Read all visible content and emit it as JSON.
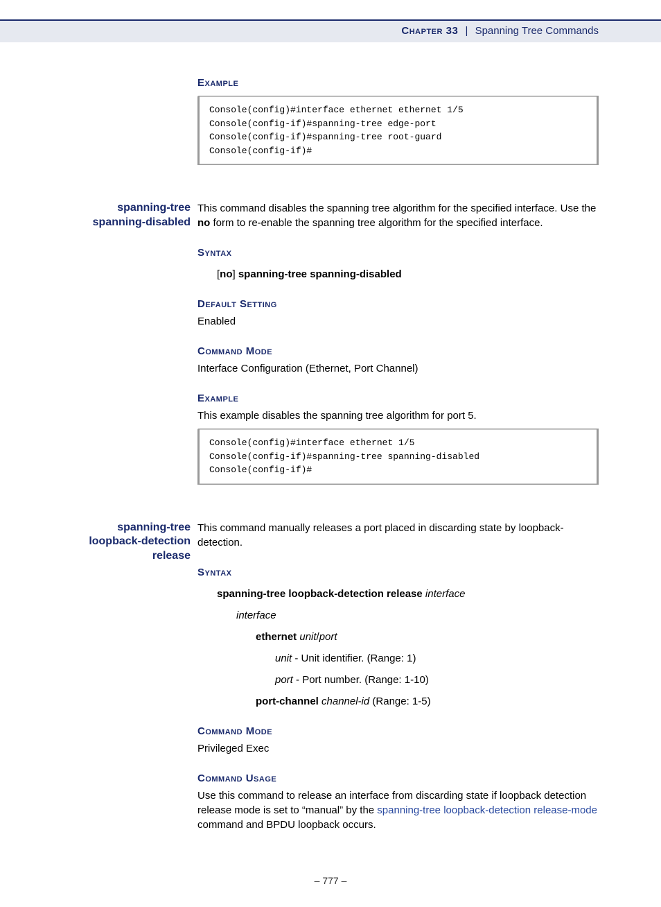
{
  "header": {
    "chapter_label": "Chapter 33",
    "sep": "|",
    "title": "Spanning Tree Commands"
  },
  "sec1": {
    "h_example": "Example",
    "code": "Console(config)#interface ethernet ethernet 1/5\nConsole(config-if)#spanning-tree edge-port\nConsole(config-if)#spanning-tree root-guard\nConsole(config-if)#"
  },
  "sec2": {
    "side": "spanning-tree spanning-disabled",
    "desc_a": "This command disables the spanning tree algorithm for the specified interface. Use the ",
    "desc_no": "no",
    "desc_b": " form to re-enable the spanning tree algorithm for the specified interface.",
    "h_syntax": "Syntax",
    "syntax_lb": "[",
    "syntax_no": "no",
    "syntax_rb": "] ",
    "syntax_cmd": "spanning-tree spanning-disabled",
    "h_default": "Default Setting",
    "default_val": "Enabled",
    "h_mode": "Command Mode",
    "mode_val": "Interface Configuration (Ethernet, Port Channel)",
    "h_example": "Example",
    "example_intro": "This example disables the spanning tree algorithm for port 5.",
    "code": "Console(config)#interface ethernet 1/5\nConsole(config-if)#spanning-tree spanning-disabled\nConsole(config-if)#"
  },
  "sec3": {
    "side": "spanning-tree loopback-detection release",
    "desc": "This command manually releases a port placed in discarding state by loopback-detection.",
    "h_syntax": "Syntax",
    "syntax_cmd": "spanning-tree loopback-detection release",
    "syntax_arg": " interface",
    "p_interface": "interface",
    "p_eth_b": "ethernet",
    "p_eth_i": " unit",
    "p_eth_slash": "/",
    "p_eth_port": "port",
    "p_unit_i": "unit",
    "p_unit_t": " - Unit identifier. (Range: 1)",
    "p_port_i": "port",
    "p_port_t": " - Port number. (Range: 1-10)",
    "p_pc_b": "port-channel",
    "p_pc_i": " channel-id",
    "p_pc_t": " (Range: 1-5)",
    "h_mode": "Command Mode",
    "mode_val": "Privileged Exec",
    "h_usage": "Command Usage",
    "usage_a": "Use this command to release an interface from discarding state if loopback detection release mode is set to “manual” by the ",
    "usage_link": "spanning-tree loopback-detection release-mode",
    "usage_b": " command and BPDU loopback occurs."
  },
  "footer": {
    "page": "–  777  –"
  }
}
